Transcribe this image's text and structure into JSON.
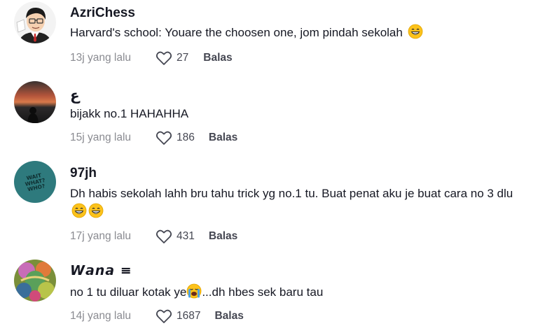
{
  "comments": [
    {
      "username": "AzriChess",
      "text": "Harvard's school: Youare the choosen one, jom pindah sekolah",
      "time": "13j yang lalu",
      "likes": "27",
      "reply": "Balas",
      "emoji": [
        "grinning-face"
      ]
    },
    {
      "username": "ع",
      "text": "bijakk no.1 HAHAHHA",
      "time": "15j yang lalu",
      "likes": "186",
      "reply": "Balas",
      "emoji": []
    },
    {
      "username": "97jh",
      "text": "Dh habis sekolah lahh bru tahu trick yg no.1 tu. Buat penat aku je buat cara no 3 dlu",
      "time": "17j yang lalu",
      "likes": "431",
      "reply": "Balas",
      "emoji": [
        "grinning-face",
        "grinning-face"
      ],
      "avatar_text": "WAIT WHAT? WHO?"
    },
    {
      "username": "𝙒𝙖𝙣𝙖 ≡",
      "text_before": "no 1 tu diluar kotak ye",
      "text_after": "...dh hbes sek baru tau",
      "time": "14j yang lalu",
      "likes": "1687",
      "reply": "Balas",
      "emoji": [
        "crying-face"
      ]
    }
  ],
  "colors": {
    "username": "#161823",
    "meta": "#8a8b91",
    "count": "#454752",
    "avatar_teal": "#2e7a7d"
  }
}
